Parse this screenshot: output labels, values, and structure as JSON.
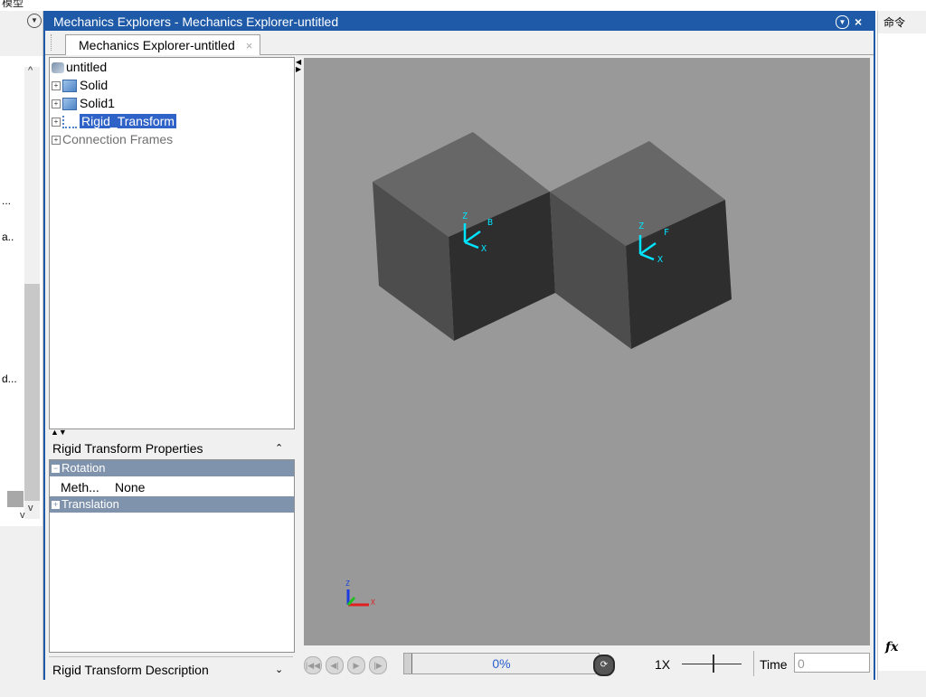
{
  "top_menu_fragment": "模型",
  "left_strip": {
    "truncated_items": [
      "...",
      "a..",
      "d..."
    ]
  },
  "window": {
    "title": "Mechanics Explorers - Mechanics Explorer-untitled",
    "tab_label": "Mechanics Explorer-untitled",
    "tab_close": "×"
  },
  "tree": {
    "items": [
      {
        "label": "untitled"
      },
      {
        "label": "Solid"
      },
      {
        "label": "Solid1"
      },
      {
        "label": "Rigid_Transform"
      },
      {
        "label": "Connection Frames"
      }
    ]
  },
  "properties": {
    "header": "Rigid Transform Properties",
    "categories": [
      {
        "label": "Rotation"
      },
      {
        "label": "Translation"
      }
    ],
    "method_label": "Meth...",
    "method_value": "None"
  },
  "description": {
    "header": "Rigid Transform Description"
  },
  "frame_labels": {
    "z": "Z",
    "x": "X",
    "f": "F",
    "b": "B"
  },
  "playback": {
    "progress_text": "0%",
    "progress_value": 0,
    "speed": "1X",
    "time_label": "Time",
    "time_value": "0"
  },
  "right_strip": {
    "label": "命令",
    "fx": "fx"
  },
  "colors": {
    "title_bar": "#1e5aa8",
    "selection": "#2f63c8",
    "category": "#8093ad",
    "viewport": "#999999",
    "frame_axes": "#00e5ff"
  }
}
